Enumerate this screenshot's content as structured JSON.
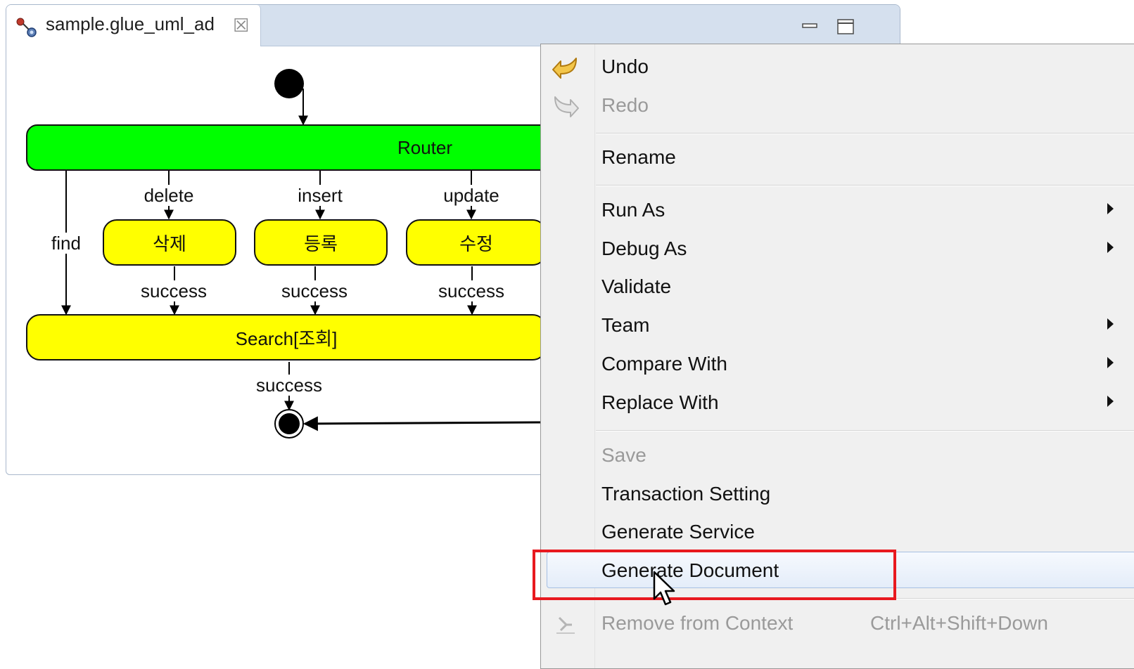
{
  "editor": {
    "tab_title": "sample.glue_uml_ad",
    "tab_icon": "activity-diagram-icon",
    "close_icon": "close-icon",
    "controls": [
      "minimize-icon",
      "maximize-icon"
    ]
  },
  "diagram": {
    "nodes": {
      "router": "Router",
      "delete_node": "삭제",
      "insert_node": "등록",
      "update_node": "수정",
      "search": "Search[조회]"
    },
    "edge_labels": {
      "find": "find",
      "delete": "delete",
      "insert": "insert",
      "update": "update",
      "delete_success": "success",
      "insert_success": "success",
      "update_success": "success",
      "search_success": "success"
    },
    "colors": {
      "router_fill": "#00ff00",
      "action_fill": "#ffff00"
    }
  },
  "context_menu": {
    "items": [
      {
        "label": "Undo",
        "icon": "undo-icon",
        "enabled": true
      },
      {
        "label": "Redo",
        "icon": "redo-icon",
        "enabled": false
      },
      {
        "label": "Rename",
        "enabled": true
      },
      {
        "label": "Run As",
        "submenu": true,
        "enabled": true
      },
      {
        "label": "Debug As",
        "submenu": true,
        "enabled": true
      },
      {
        "label": "Validate",
        "enabled": true
      },
      {
        "label": "Team",
        "submenu": true,
        "enabled": true
      },
      {
        "label": "Compare With",
        "submenu": true,
        "enabled": true
      },
      {
        "label": "Replace With",
        "submenu": true,
        "enabled": true
      },
      {
        "label": "Save",
        "enabled": false
      },
      {
        "label": "Transaction Setting",
        "enabled": true
      },
      {
        "label": "Generate Service",
        "enabled": true
      },
      {
        "label": "Generate Document",
        "enabled": true,
        "hovered": true
      },
      {
        "label": "Remove from Context",
        "icon": "remove-context-icon",
        "shortcut": "Ctrl+Alt+Shift+Down",
        "enabled": false
      }
    ],
    "highlight_color": "#e8191f"
  }
}
